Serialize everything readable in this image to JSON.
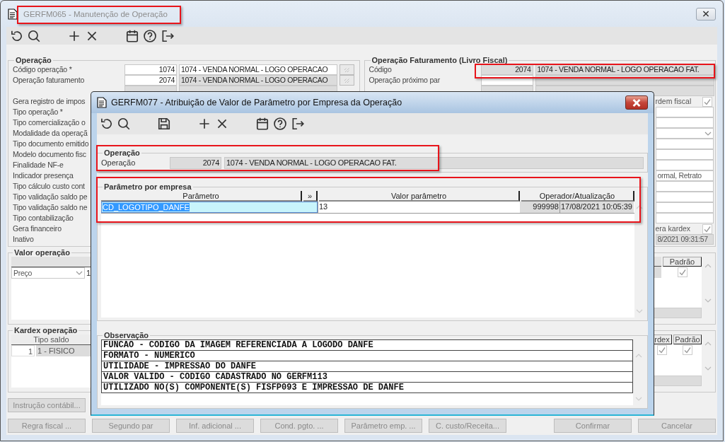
{
  "main_window": {
    "title": "GERFM065 - Manutenção de Operação",
    "operacao": {
      "title": "Operação",
      "rows": [
        {
          "kind": "lookup",
          "label": "Código operação *",
          "code": "1074",
          "description": "1074 - VENDA NORMAL - LOGO OPERACAO"
        },
        {
          "kind": "lookup",
          "label": "Operação faturamento",
          "code": "2074",
          "description": "1074 - VENDA NORMAL - LOGO OPERACAO"
        },
        {
          "kind": "covered"
        },
        {
          "kind": "label",
          "label": "Gera registro de impos"
        },
        {
          "kind": "label",
          "label": "Tipo operação *"
        },
        {
          "kind": "label",
          "label": "Tipo comercialização o"
        },
        {
          "kind": "label",
          "label": "Modalidade da operaçã"
        },
        {
          "kind": "label",
          "label": "Tipo documento emitido"
        },
        {
          "kind": "label",
          "label": "Modelo documento fisc"
        },
        {
          "kind": "label",
          "label": "Finalidade NF-e"
        },
        {
          "kind": "label",
          "label": "Indicador presença"
        },
        {
          "kind": "label",
          "label": "Tipo cálculo custo cont"
        },
        {
          "kind": "label",
          "label": "Tipo validação saldo pe"
        },
        {
          "kind": "label",
          "label": "Tipo validação saldo ne"
        },
        {
          "kind": "label",
          "label": "Tipo contabilização"
        },
        {
          "kind": "label",
          "label": "Gera financeiro"
        },
        {
          "kind": "label",
          "label": "Inativo"
        }
      ]
    },
    "operacao_faturamento": {
      "title": "Operação Faturamento (Livro Fiscal)",
      "rows": [
        {
          "kind": "lookup",
          "label": "Código",
          "code": "2074",
          "description": "1074 - VENDA NORMAL - LOGO OPERACAO FAT."
        },
        {
          "kind": "lookup",
          "label": "Operação próximo par"
        },
        {
          "kind": "covered"
        },
        {
          "kind": "check",
          "text": "rdem fiscal",
          "checked": true
        },
        {
          "kind": "field"
        },
        {
          "kind": "field"
        },
        {
          "kind": "dropdown"
        },
        {
          "kind": "field"
        },
        {
          "kind": "field"
        },
        {
          "kind": "field"
        },
        {
          "kind": "value",
          "text": "ormal, Retrato"
        },
        {
          "kind": "field"
        },
        {
          "kind": "field"
        },
        {
          "kind": "field"
        },
        {
          "kind": "field"
        },
        {
          "kind": "check",
          "text": "era kardex",
          "checked": true
        },
        {
          "kind": "readonly",
          "text": "8/2021 09:31:57"
        }
      ]
    },
    "valor_operacao": {
      "title": "Valor operação",
      "dropdown": "Preço",
      "cell": "1",
      "right_columns": [
        "Padrão"
      ],
      "right_checks": [
        {
          "checked": true
        }
      ]
    },
    "kardex_operacao": {
      "title": "Kardex operação",
      "column": "Tipo saldo",
      "row": {
        "number": "1",
        "tipo": "1 - FISICO"
      },
      "right_columns": [
        "rdex",
        "Padrão"
      ],
      "right_checks": [
        {
          "checked": true
        },
        {
          "checked": true
        }
      ]
    },
    "instrucao_button": {
      "label": "Instrução contábil...",
      "disabled": true
    },
    "buttons": [
      {
        "label": "Regra fiscal ...",
        "disabled": true
      },
      {
        "label": "Segundo par",
        "disabled": true
      },
      {
        "label": "Inf. adicional ...",
        "disabled": true
      },
      {
        "label": "Cond. pgto. ...",
        "disabled": true
      },
      {
        "label": "Parâmetro emp. ...",
        "disabled": true
      },
      {
        "label": "C. custo/Receita...",
        "disabled": true
      }
    ],
    "confirm_buttons": [
      {
        "label": "Confirmar",
        "disabled": true
      },
      {
        "label": "Cancelar",
        "disabled": true
      }
    ]
  },
  "dialog": {
    "title": "GERFM077 - Atribuição de Valor de Parâmetro por Empresa da Operação",
    "operacao": {
      "title": "Operação",
      "label": "Operação",
      "code": "2074",
      "description": "1074 - VENDA NORMAL - LOGO OPERACAO FAT."
    },
    "parametros": {
      "title": "Parâmetro por empresa",
      "columns": [
        "Parâmetro",
        "»",
        "Valor parâmetro",
        "Operador/Atualização"
      ],
      "rows": [
        {
          "parametro": "CD_LOGOTIPO_DANFE",
          "valor": "13",
          "operador": "999998",
          "atualizacao": "17/08/2021 10:05:39",
          "selected": true
        }
      ]
    },
    "observacao": {
      "title": "Observação",
      "lines": [
        "FUNCAO - CODIGO DA IMAGEM REFERENCIADA A LOGODO DANFE",
        "FORMATO - NUMERICO",
        "UTILIDADE - IMPRESSAO DO DANFE",
        "VALOR VALIDO - CODIGO CADASTRADO NO GERFM113",
        "UTILIZADO NO(S) COMPONENTE(S) FISFP093 E IMPRESSAO DE DANFE"
      ]
    }
  }
}
